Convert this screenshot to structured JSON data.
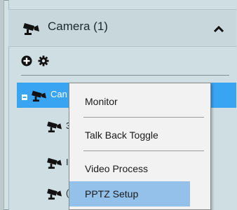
{
  "panel": {
    "title": "Camera (1)",
    "collapse_icon": "chevron-up-icon"
  },
  "toolbar": {
    "add_icon": "add-circle-icon",
    "settings_icon": "gear-icon"
  },
  "tree": {
    "selected_node": {
      "label": "Can",
      "expand_icon": "minus-icon",
      "icon": "camera-icon"
    },
    "children": [
      {
        "trail": "3",
        "icon": "camera-icon"
      },
      {
        "trail": "I",
        "icon": "camera-icon"
      },
      {
        "trail": "(",
        "icon": "camera-icon"
      }
    ]
  },
  "context_menu": {
    "items": [
      {
        "label": "Monitor"
      },
      {
        "label": "Talk Back Toggle"
      },
      {
        "label": "Video Process"
      },
      {
        "label": "PPTZ Setup",
        "highlighted": true
      }
    ]
  },
  "colors": {
    "panel_bg": "#cfdee2",
    "selection": "#39a4f2",
    "menu_bg": "#f2f2f2",
    "menu_highlight": "#93c1ea"
  }
}
